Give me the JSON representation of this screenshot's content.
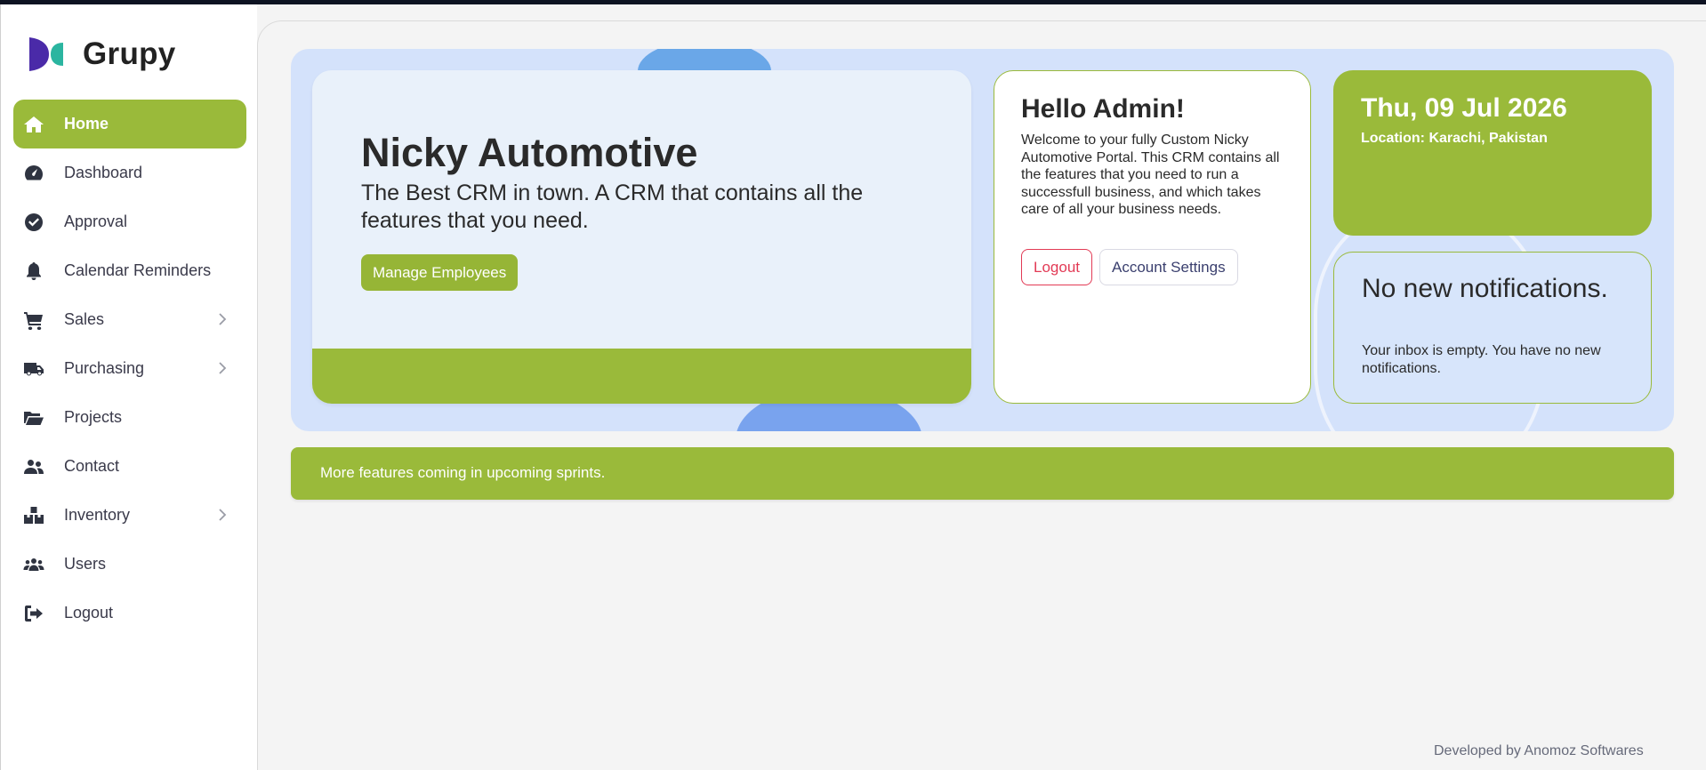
{
  "brand": {
    "name": "Grupy",
    "logo_colors": [
      "#4a2aa8",
      "#2bb5a0"
    ]
  },
  "sidebar": {
    "items": [
      {
        "label": "Home",
        "icon": "home-icon",
        "active": true,
        "has_submenu": false
      },
      {
        "label": "Dashboard",
        "icon": "gauge-icon",
        "active": false,
        "has_submenu": false
      },
      {
        "label": "Approval",
        "icon": "check-circle-icon",
        "active": false,
        "has_submenu": false
      },
      {
        "label": "Calendar Reminders",
        "icon": "bell-icon",
        "active": false,
        "has_submenu": false
      },
      {
        "label": "Sales",
        "icon": "cart-icon",
        "active": false,
        "has_submenu": true
      },
      {
        "label": "Purchasing",
        "icon": "truck-icon",
        "active": false,
        "has_submenu": true
      },
      {
        "label": "Projects",
        "icon": "folder-open-icon",
        "active": false,
        "has_submenu": false
      },
      {
        "label": "Contact",
        "icon": "user-pair-icon",
        "active": false,
        "has_submenu": false
      },
      {
        "label": "Inventory",
        "icon": "boxes-icon",
        "active": false,
        "has_submenu": true
      },
      {
        "label": "Users",
        "icon": "users-icon",
        "active": false,
        "has_submenu": false
      },
      {
        "label": "Logout",
        "icon": "sign-out-icon",
        "active": false,
        "has_submenu": false
      }
    ]
  },
  "hero": {
    "title": "Nicky Automotive",
    "tagline": "The Best CRM in town. A CRM that contains all the features that you need.",
    "manage_button": "Manage Employees"
  },
  "greeting": {
    "title": "Hello Admin!",
    "text": "Welcome to your fully Custom Nicky Automotive Portal. This CRM contains all the features that you need to run a successfull business, and which takes care of all your business needs.",
    "logout_button": "Logout",
    "settings_button": "Account Settings"
  },
  "date_card": {
    "date": "Thu, 09 Jul 2026",
    "location": "Location: Karachi, Pakistan"
  },
  "notifications": {
    "title": "No new notifications.",
    "text": "Your inbox is empty. You have no new notifications."
  },
  "banner": {
    "text": "More features coming in upcoming sprints."
  },
  "footer": {
    "text": "Developed by Anomoz Softwares"
  },
  "colors": {
    "accent": "#9aba3a",
    "hero_bg": "#d4e2fb",
    "danger": "#e23a55"
  }
}
